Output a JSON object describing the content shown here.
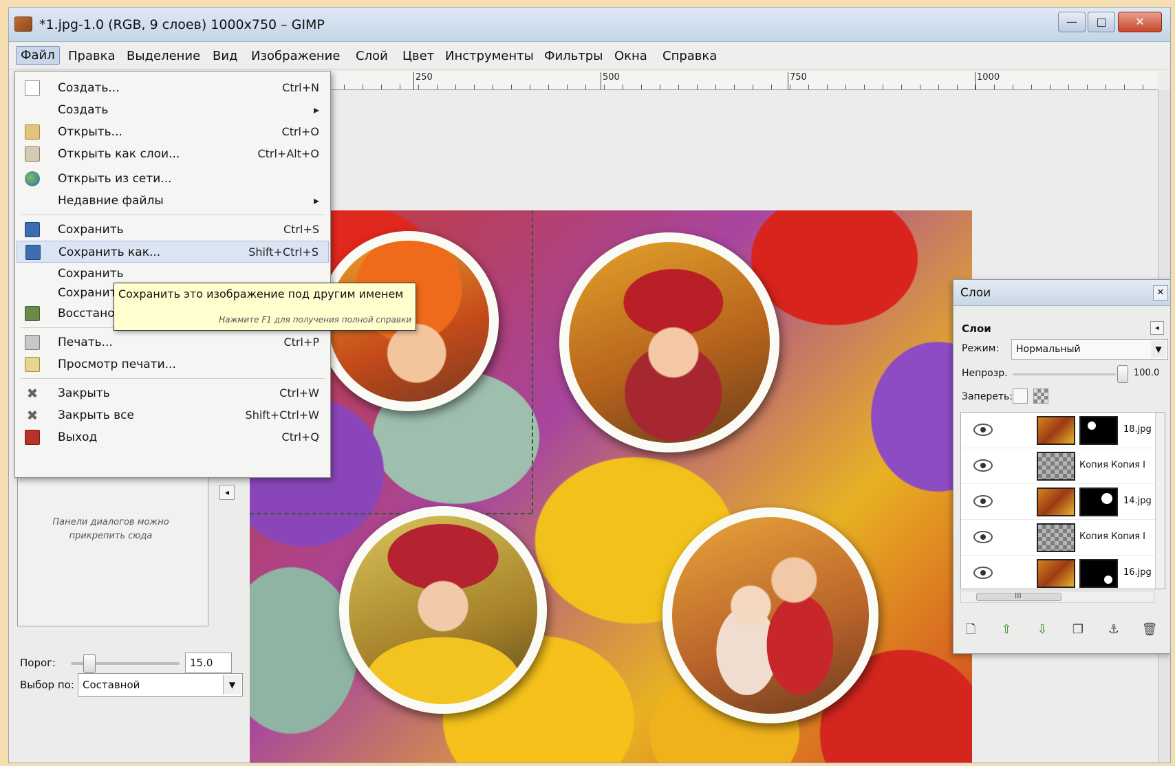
{
  "window": {
    "title": "*1.jpg-1.0 (RGB, 9 слоев) 1000x750 – GIMP",
    "minimize": "—",
    "maximize": "□",
    "close": "✕"
  },
  "menubar": [
    "Файл",
    "Правка",
    "Выделение",
    "Вид",
    "Изображение",
    "Слой",
    "Цвет",
    "Инструменты",
    "Фильтры",
    "Окна",
    "Справка"
  ],
  "ruler": [
    "250",
    "500",
    "750",
    "1000"
  ],
  "file_menu": {
    "items": [
      {
        "label": "Создать...",
        "shortcut": "Ctrl+N",
        "icon": "new-document-icon"
      },
      {
        "label": "Создать",
        "shortcut": "▸",
        "icon": ""
      },
      {
        "label": "Открыть...",
        "shortcut": "Ctrl+O",
        "icon": "folder-icon"
      },
      {
        "label": "Открыть как слои...",
        "shortcut": "Ctrl+Alt+O",
        "icon": "open-layers-icon"
      },
      {
        "label": "Открыть из сети...",
        "shortcut": "",
        "icon": "globe-icon"
      },
      {
        "label": "Недавние файлы",
        "shortcut": "▸",
        "icon": ""
      },
      {
        "label": "Сохранить",
        "shortcut": "Ctrl+S",
        "icon": "save-icon"
      },
      {
        "label": "Сохранить как...",
        "shortcut": "Shift+Ctrl+S",
        "icon": "save-as-icon"
      },
      {
        "label": "Сохранить",
        "shortcut": "",
        "icon": ""
      },
      {
        "label": "Сохранить",
        "shortcut": "",
        "icon": ""
      },
      {
        "label": "Восстановить",
        "shortcut": "",
        "icon": "revert-icon"
      },
      {
        "label": "Печать...",
        "shortcut": "Ctrl+P",
        "icon": "printer-icon"
      },
      {
        "label": "Просмотр печати...",
        "shortcut": "",
        "icon": "print-preview-icon"
      },
      {
        "label": "Закрыть",
        "shortcut": "Ctrl+W",
        "icon": "close-x-icon"
      },
      {
        "label": "Закрыть все",
        "shortcut": "Shift+Ctrl+W",
        "icon": "close-all-icon"
      },
      {
        "label": "Выход",
        "shortcut": "Ctrl+Q",
        "icon": "exit-icon"
      }
    ]
  },
  "tooltip": {
    "text": "Сохранить это изображение под другим именем",
    "hint": "Нажмите F1 для получения полной справки"
  },
  "left_dock": {
    "hint": "Панели диалогов можно прикрепить сюда",
    "threshold_label": "Порог:",
    "threshold_value": "15.0",
    "select_by_label": "Выбор по:",
    "select_by_value": "Составной"
  },
  "layers_panel": {
    "title": "Слои",
    "heading": "Слои",
    "mode_label": "Режим:",
    "mode_value": "Нормальный",
    "opacity_label": "Непрозр.",
    "opacity_value": "100.0",
    "lock_label": "Запереть:",
    "layers": [
      {
        "name": "18.jpg",
        "has_mask": true
      },
      {
        "name": "Копия Копия I",
        "has_mask": false
      },
      {
        "name": "14.jpg",
        "has_mask": true
      },
      {
        "name": "Копия Копия I",
        "has_mask": false
      },
      {
        "name": "16.jpg",
        "has_mask": true
      }
    ],
    "scroll_marker": "III"
  },
  "colors": {
    "accent_highlight": "#dbe4f2",
    "tooltip_bg": "#fffecf",
    "frame_bg": "#f7deb0"
  }
}
